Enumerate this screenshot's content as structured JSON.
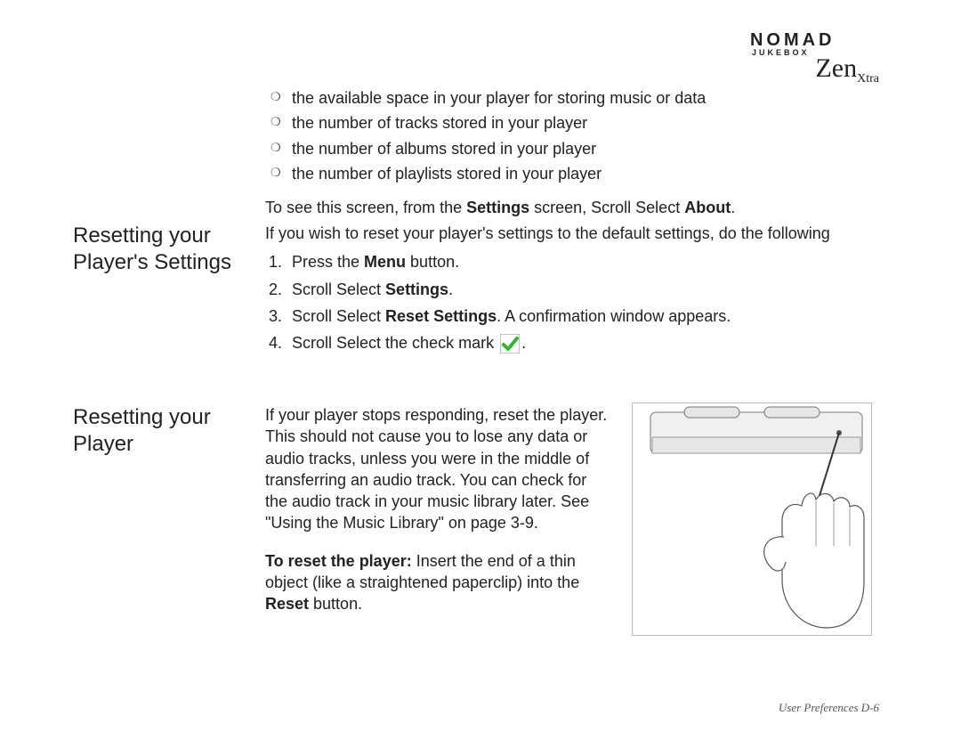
{
  "logo": {
    "brand": "NOMAD",
    "sub": "JUKEBOX",
    "model1": "Zen",
    "model2": "Xtra"
  },
  "top": {
    "bullets": [
      "the available space in your player for storing music or data",
      "the number of tracks stored in your player",
      "the number of albums stored in your player",
      "the number of playlists stored in your player"
    ],
    "see_prefix": "To see this screen, from the ",
    "see_bold1": "Settings",
    "see_mid": " screen, Scroll Select ",
    "see_bold2": "About",
    "see_suffix": "."
  },
  "section1": {
    "heading": "Resetting your Player's Settings",
    "intro": "If you wish to reset your player's settings to the default settings, do the following",
    "step1_pre": "Press the ",
    "step1_bold": "Menu",
    "step1_post": " button.",
    "step2_pre": "Scroll Select ",
    "step2_bold": "Settings",
    "step2_post": ".",
    "step3_pre": "Scroll Select ",
    "step3_bold": "Reset Settings",
    "step3_post": ". A confirmation window appears.",
    "step4_pre": "Scroll Select the check mark ",
    "step4_post": "."
  },
  "section2": {
    "heading": "Resetting your Player",
    "para1": "If your player stops responding, reset the player. This should not cause you to lose any data or audio tracks, unless you were in the middle of transferring an audio track. You can check for the audio track in your music library later. See \"Using the Music Library\" on page 3-9.",
    "para2_bold": "To reset the player:",
    "para2_rest_a": " Insert the end of a thin object (like a straightened paperclip) into the ",
    "para2_bold2": "Reset",
    "para2_rest_b": " button."
  },
  "footer": "User Preferences D-6"
}
